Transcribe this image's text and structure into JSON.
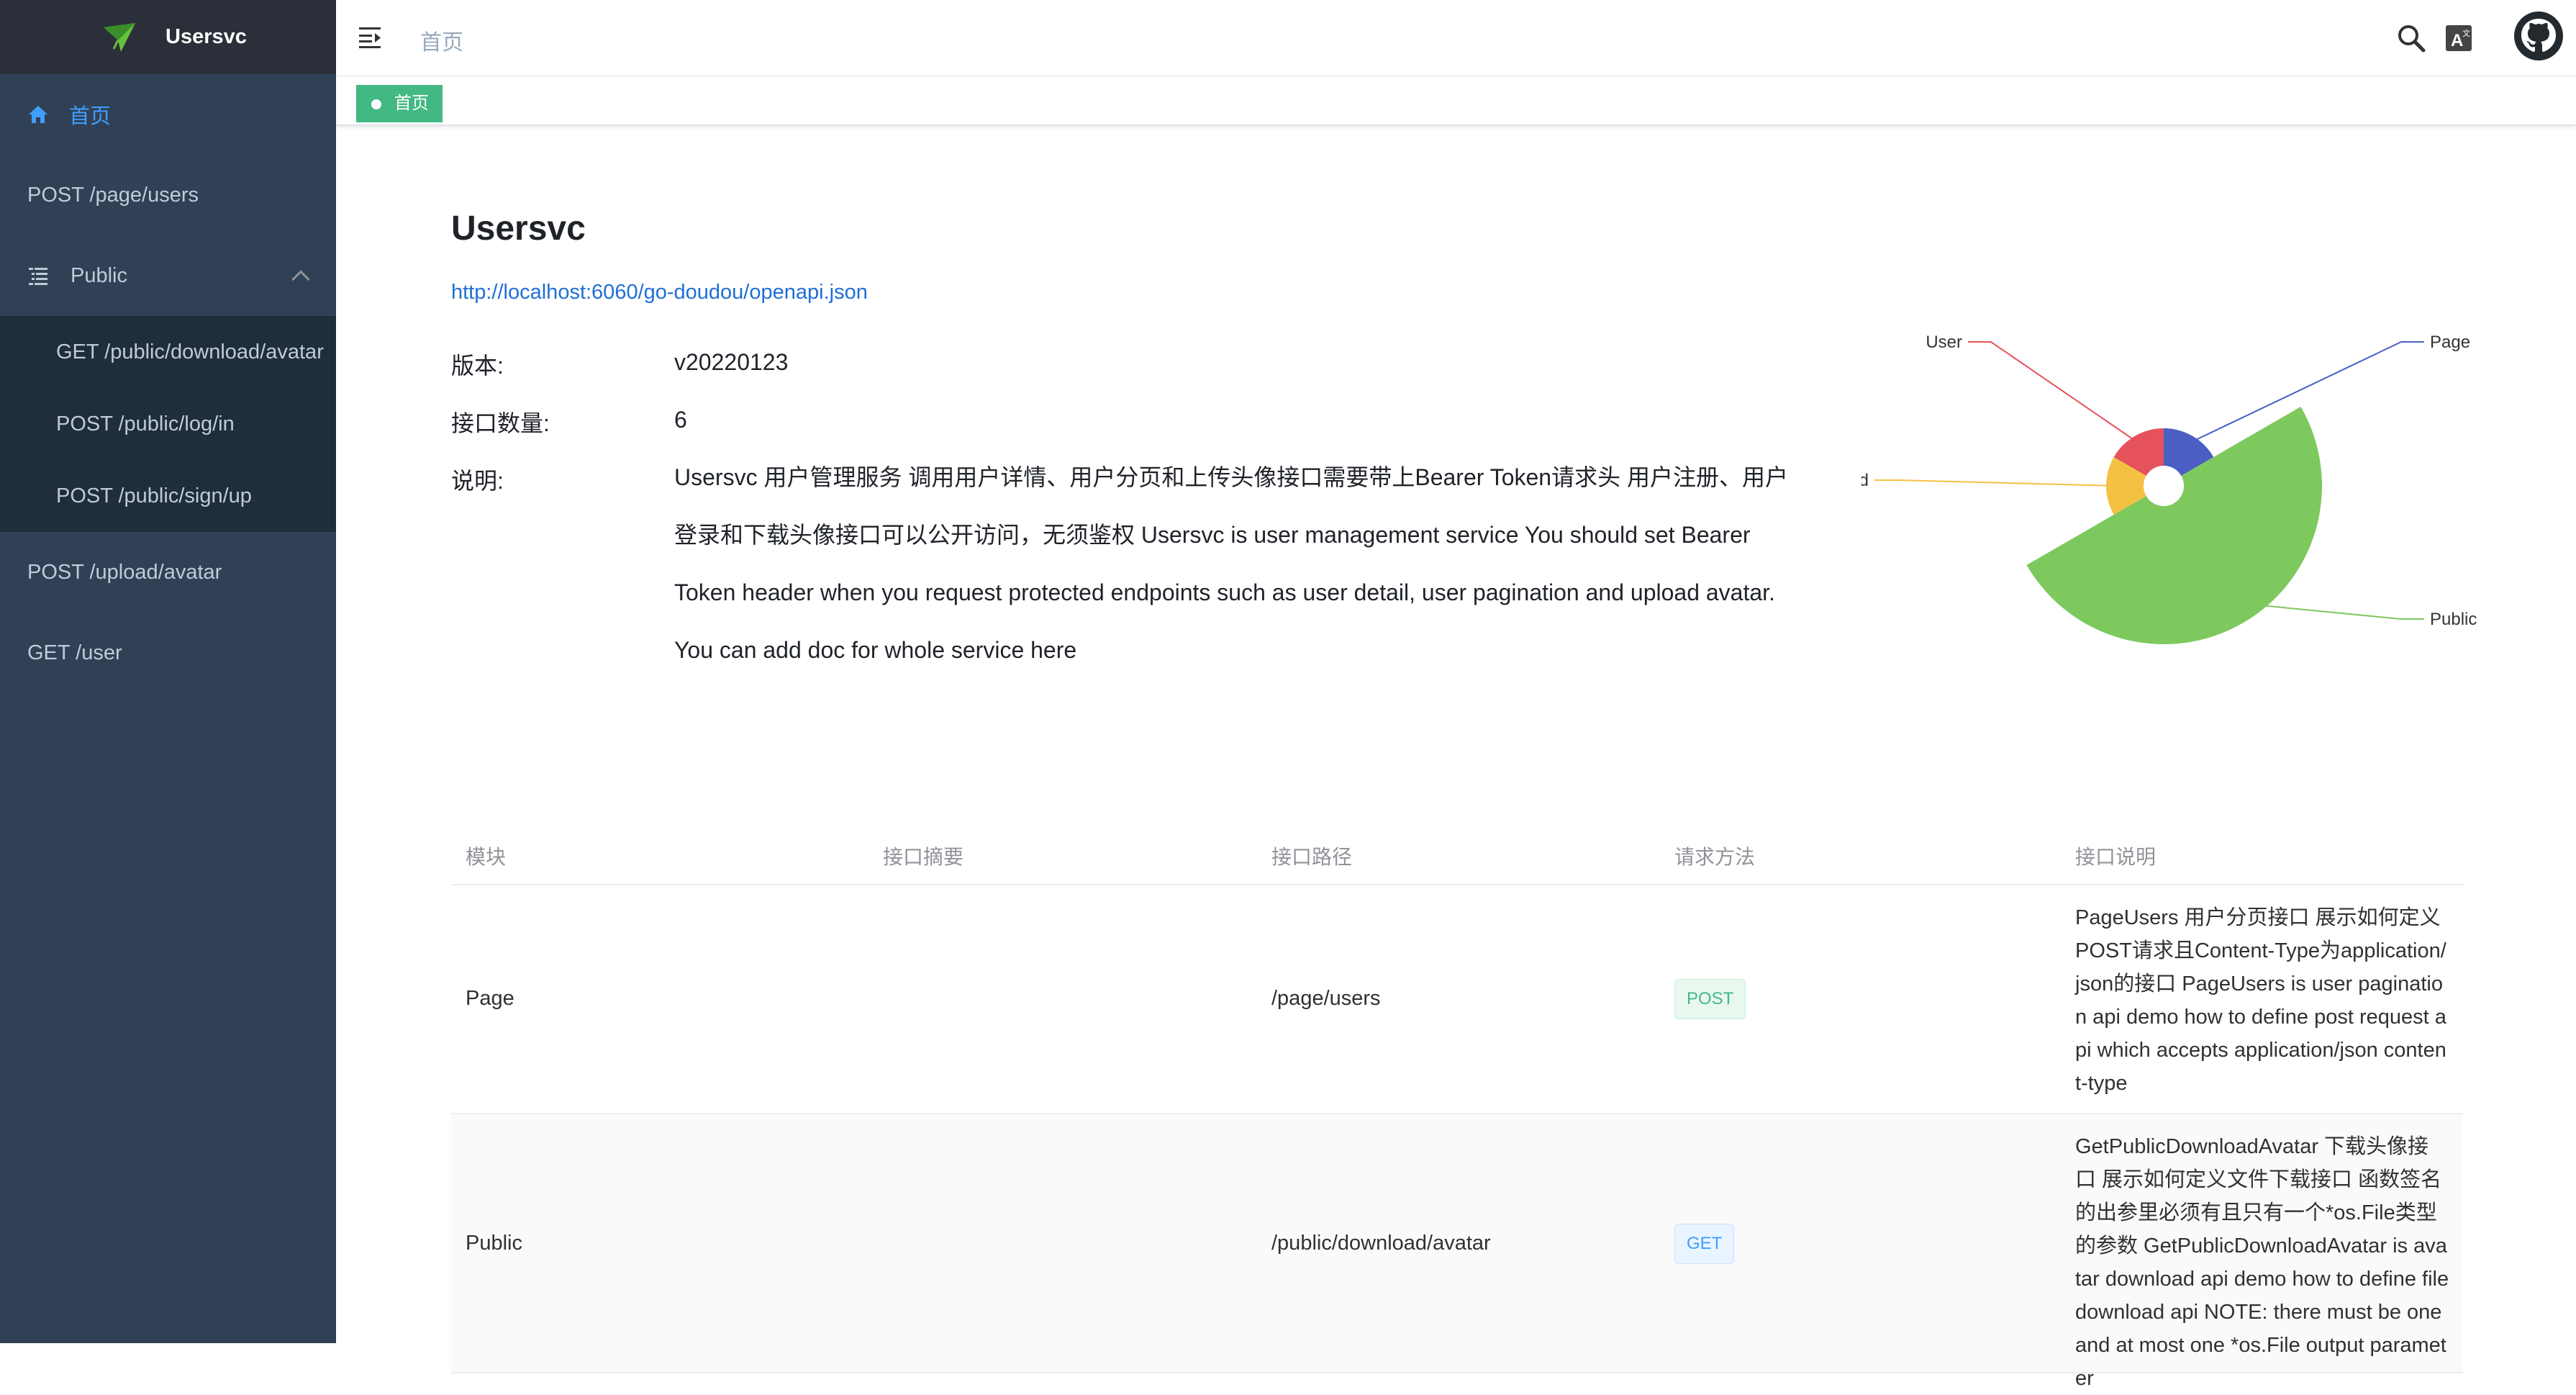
{
  "app": {
    "title": "Usersvc"
  },
  "sidebar": {
    "home": "首页",
    "items": [
      {
        "label": "POST /page/users"
      },
      {
        "label": "Public"
      },
      {
        "label": "POST /upload/avatar"
      },
      {
        "label": "GET /user"
      }
    ],
    "public_children": [
      {
        "label": "GET /public/download/avatar"
      },
      {
        "label": "POST /public/log/in"
      },
      {
        "label": "POST /public/sign/up"
      }
    ]
  },
  "navbar": {
    "breadcrumb": "首页",
    "icons": [
      "menu-fold-icon",
      "search-icon",
      "translate-icon",
      "github-icon"
    ]
  },
  "tags": {
    "active": "首页"
  },
  "overview": {
    "title": "Usersvc",
    "url": "http://localhost:6060/go-doudou/openapi.json",
    "version_label": "版本:",
    "version": "v20220123",
    "count_label": "接口数量:",
    "count": "6",
    "desc_label": "说明:",
    "desc": "Usersvc 用户管理服务 调用用户详情、用户分页和上传头像接口需要带上Bearer Token请求头 用户注册、用户登录和下载头像接口可以公开访问，无须鉴权 Usersvc is user management service You should set Bearer Token header when you request protected endpoints such as user detail, user pagination and upload avatar. You can add doc for whole service here"
  },
  "chart_data": {
    "type": "pie",
    "variant": "rose",
    "categories": [
      "Page",
      "Public",
      "Upload",
      "User"
    ],
    "values": [
      1,
      3,
      1,
      1
    ],
    "colors": [
      "#4b5ec4",
      "#7dc95e",
      "#f5c142",
      "#e5525c"
    ],
    "title": "",
    "legend": "none"
  },
  "table": {
    "headers": [
      "模块",
      "接口摘要",
      "接口路径",
      "请求方法",
      "接口说明"
    ],
    "rows": [
      {
        "module": "Page",
        "summary": "",
        "path": "/page/users",
        "method": "POST",
        "desc": "PageUsers 用户分页接口 展示如何定义POST请求且Content-Type为application/json的接口 PageUsers is user pagination api demo how to define post request api which accepts application/json content-type"
      },
      {
        "module": "Public",
        "summary": "",
        "path": "/public/download/avatar",
        "method": "GET",
        "desc": "GetPublicDownloadAvatar 下载头像接口 展示如何定义文件下载接口 函数签名的出参里必须有且只有一个*os.File类型的参数 GetPublicDownloadAvatar is avatar download api demo how to define file download api NOTE: there must be one and at most one *os.File output parameter"
      }
    ]
  }
}
